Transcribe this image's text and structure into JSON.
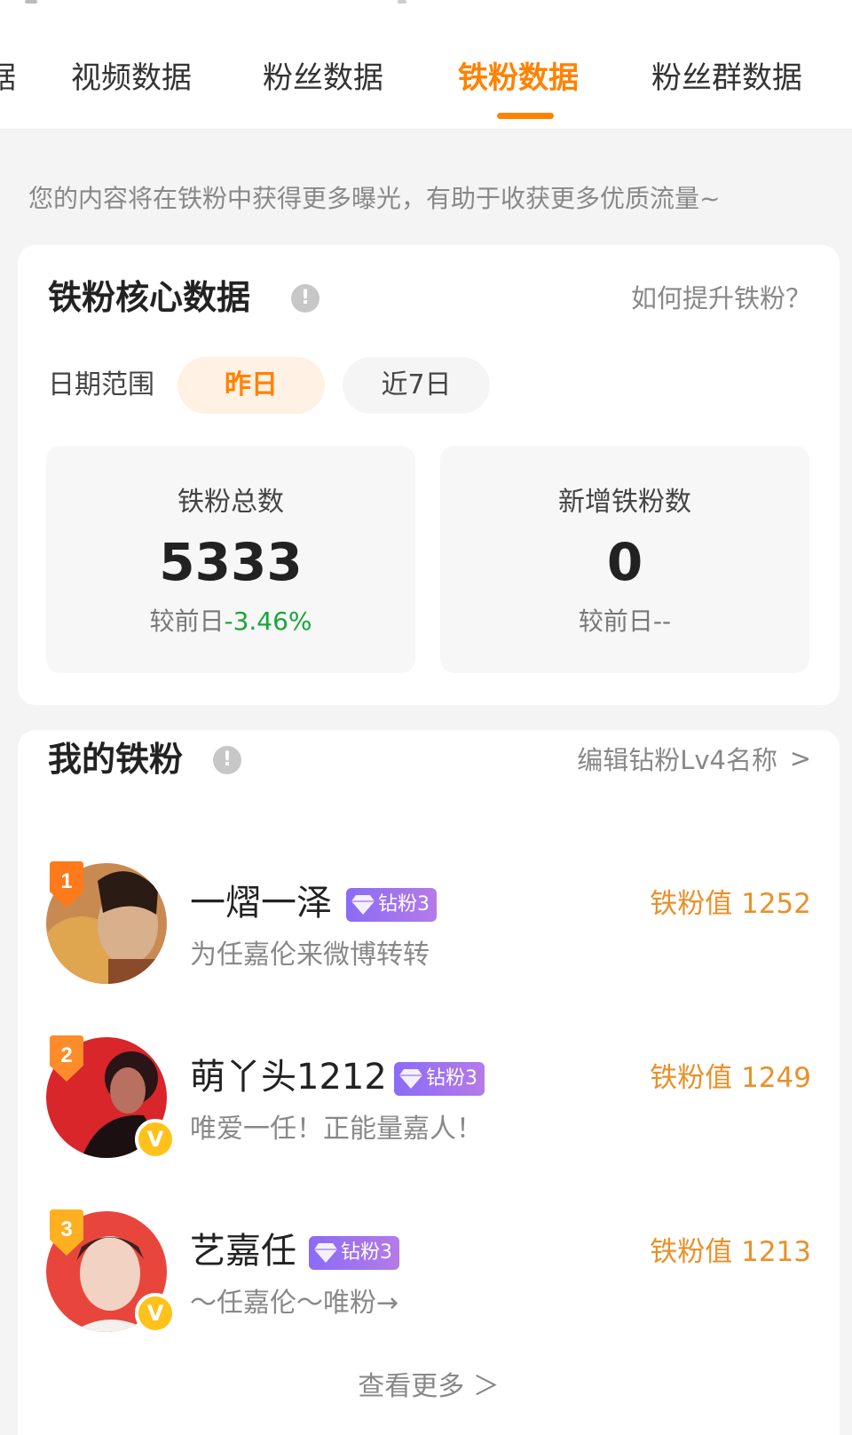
{
  "tabs": [
    {
      "label": "据"
    },
    {
      "label": "视频数据"
    },
    {
      "label": "粉丝数据"
    },
    {
      "label": "铁粉数据"
    },
    {
      "label": "粉丝群数据"
    }
  ],
  "tip": "您的内容将在铁粉中获得更多曝光，有助于收获更多优质流量~",
  "core": {
    "title": "铁粉核心数据",
    "info_glyph": "!",
    "link": "如何提升铁粉？",
    "date_label": "日期范围",
    "ranges": [
      "昨日",
      "近7日"
    ],
    "selected_range": "昨日",
    "stats": [
      {
        "label": "铁粉总数",
        "value": "5333",
        "cmp_prefix": "较前日",
        "cmp_value": "-3.46%"
      },
      {
        "label": "新增铁粉数",
        "value": "0",
        "cmp_prefix": "较前日",
        "cmp_value": "--"
      }
    ]
  },
  "fans": {
    "title": "我的铁粉",
    "info_glyph": "!",
    "link": "编辑钻粉Lv4名称",
    "link_arrow": ">",
    "items": [
      {
        "rank": "1",
        "name": "一熠一泽",
        "badge": "钻粉3",
        "signature": "为任嘉伦来微博转转",
        "score": "铁粉值 1252",
        "verified": false,
        "verified_glyph": ""
      },
      {
        "rank": "2",
        "name": "萌丫头1212",
        "badge": "钻粉3",
        "signature": "唯爱一任！正能量嘉人！",
        "score": "铁粉值 1249",
        "verified": true,
        "verified_glyph": "V"
      },
      {
        "rank": "3",
        "name": "艺嘉任",
        "badge": "钻粉3",
        "signature": "～任嘉伦～唯粉→",
        "score": "铁粉值 1213",
        "verified": true,
        "verified_glyph": "V"
      }
    ],
    "more": "查看更多 ＞"
  },
  "colors": {
    "accent": "#ff8200",
    "score": "#e8912a",
    "down": "#1aa53c",
    "badge": "#9b72f0",
    "verified": "#ffc21a"
  }
}
